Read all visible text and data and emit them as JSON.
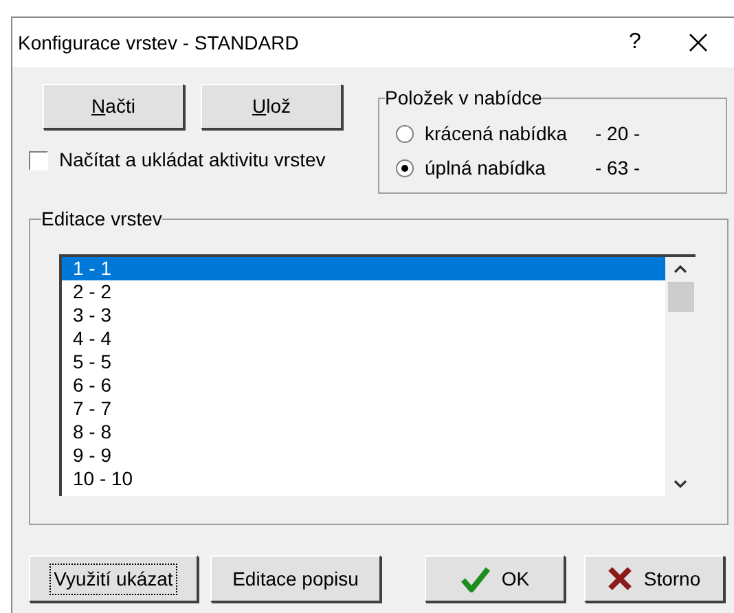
{
  "window": {
    "title": "Konfigurace vrstev - STANDARD",
    "help": "?"
  },
  "top_buttons": [
    {
      "label": "Načti",
      "underline_first": true
    },
    {
      "label": "Ulož",
      "underline_first": true
    }
  ],
  "checkbox": {
    "label": "Načítat a ukládat aktivitu vrstev",
    "checked": false
  },
  "menu_group": {
    "title": "Položek v nabídce",
    "options": [
      {
        "label": "krácená nabídka",
        "count": "- 20 -",
        "selected": false
      },
      {
        "label": "úplná nabídka",
        "count": "- 63 -",
        "selected": true
      }
    ]
  },
  "layers_group": {
    "title": "Editace vrstev",
    "items": [
      {
        "label": "1 - 1",
        "selected": true
      },
      {
        "label": "2 - 2",
        "selected": false
      },
      {
        "label": "3 - 3",
        "selected": false
      },
      {
        "label": "4 - 4",
        "selected": false
      },
      {
        "label": "5 - 5",
        "selected": false
      },
      {
        "label": "6 - 6",
        "selected": false
      },
      {
        "label": "7 - 7",
        "selected": false
      },
      {
        "label": "8 - 8",
        "selected": false
      },
      {
        "label": "9 - 9",
        "selected": false
      },
      {
        "label": "10 - 10",
        "selected": false
      }
    ]
  },
  "bottom_buttons": [
    {
      "label": "Využití ukázat",
      "kind": "focused"
    },
    {
      "label": "Editace popisu",
      "kind": "plain"
    },
    {
      "label": "OK",
      "kind": "ok"
    },
    {
      "label": "Storno",
      "kind": "cancel"
    }
  ]
}
